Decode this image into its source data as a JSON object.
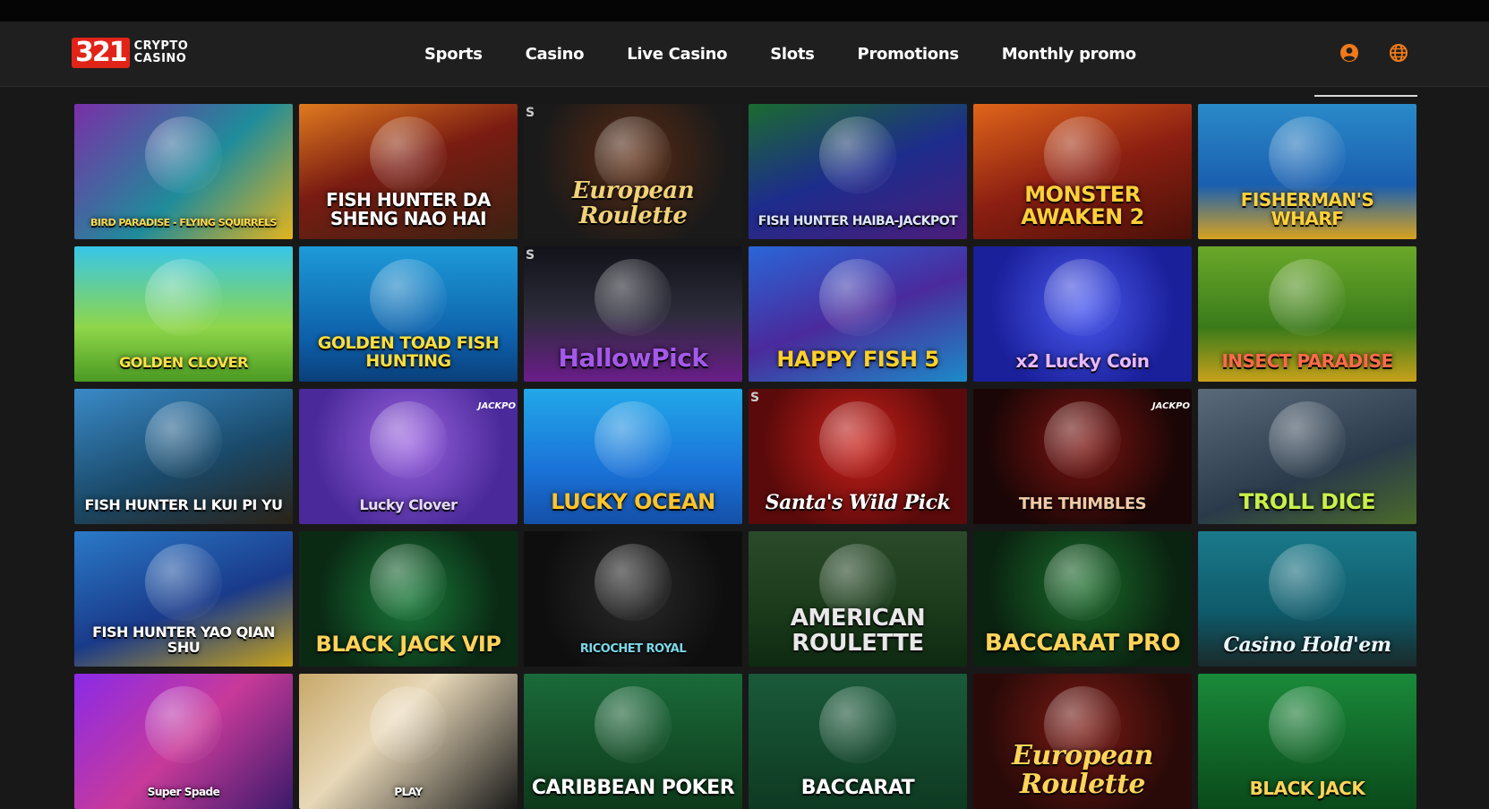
{
  "header": {
    "logo_number": "321",
    "logo_line1": "CRYPTO",
    "logo_line2": "CASINO",
    "nav": [
      "Sports",
      "Casino",
      "Live Casino",
      "Slots",
      "Promotions",
      "Monthly promo"
    ],
    "accent": "#f07a1a"
  },
  "games": [
    {
      "title": "BIRD PARADISE - FLYING SQUIRRELS",
      "bg": "linear-gradient(135deg,#7a2fa8,#1f8c9a 55%,#e3b41c)",
      "color": "#ffd84a",
      "size": 11
    },
    {
      "title": "FISH HUNTER DA SHENG NAO HAI",
      "bg": "linear-gradient(160deg,#e07a1f,#7a1c12 45%,#3a2212)",
      "color": "#ffffff",
      "size": 20
    },
    {
      "title": "European Roulette",
      "bg": "radial-gradient(circle at 50% 40%,#5a2a12,#1a1a1a 70%)",
      "color": "#f1d27a",
      "size": 26,
      "serif": true,
      "s": "S"
    },
    {
      "title": "FISH HUNTER HAIBA-JACKPOT",
      "bg": "linear-gradient(160deg,#1b6b30,#1d2c8c 50%,#4b1d7a)",
      "color": "#dde7ff",
      "size": 14
    },
    {
      "title": "MONSTER AWAKEN 2",
      "bg": "linear-gradient(160deg,#e0651a,#8c1f12 50%,#4a1008)",
      "color": "#ffcf3a",
      "size": 24
    },
    {
      "title": "FISHERMAN'S WHARF",
      "bg": "linear-gradient(180deg,#2a8ac8,#1a5fb0 60%,#d8a21f)",
      "color": "#ffd13a",
      "size": 20
    },
    {
      "title": "GOLDEN CLOVER",
      "bg": "linear-gradient(180deg,#38c6e8,#8fd64a 60%,#4a9a22)",
      "color": "#ffe04a",
      "size": 16
    },
    {
      "title": "GOLDEN TOAD FISH HUNTING",
      "bg": "linear-gradient(180deg,#1e9ad8,#0d5ea8 70%,#0a3f7a)",
      "color": "#ffde3a",
      "size": 19
    },
    {
      "title": "HallowPick",
      "bg": "linear-gradient(180deg,#12121a,#2c2c3a 50%,#6a1d8a)",
      "color": "#a35ae8",
      "size": 28,
      "s": "S"
    },
    {
      "title": "HAPPY FISH 5",
      "bg": "linear-gradient(160deg,#2a66d8,#4a2a9c 50%,#1d8ac8)",
      "color": "#ffd02a",
      "size": 24
    },
    {
      "title": "x2 Lucky Coin",
      "bg": "radial-gradient(circle at 50% 45%,#4a5af0,#1a1f9a 70%)",
      "color": "#e9b8ff",
      "size": 20
    },
    {
      "title": "INSECT PARADISE",
      "bg": "linear-gradient(180deg,#6aa82a,#3a7a1a 60%,#c8a21a)",
      "color": "#ff6a4a",
      "size": 20
    },
    {
      "title": "FISH HUNTER LI KUI PI YU",
      "bg": "linear-gradient(160deg,#3a8ac8,#1a4a6a 55%,#2a2218)",
      "color": "#ffffff",
      "size": 16
    },
    {
      "title": "Lucky Clover",
      "bg": "radial-gradient(circle at 50% 40%,#9a62e0,#4a2a9a 70%)",
      "color": "#e6daff",
      "size": 16,
      "badge": "JACKPO"
    },
    {
      "title": "LUCKY OCEAN",
      "bg": "linear-gradient(180deg,#22a8e8,#1a72d8 60%,#1450a8)",
      "color": "#ffc42a",
      "size": 24
    },
    {
      "title": "Santa's Wild Pick",
      "bg": "radial-gradient(circle at 50% 40%,#c8201a,#5a0a0a 70%)",
      "color": "#ffffff",
      "size": 22,
      "serif": true,
      "s": "S"
    },
    {
      "title": "THE THIMBLES",
      "bg": "radial-gradient(circle at 50% 40%,#7a1410,#1a0606 70%)",
      "color": "#f0c9a8",
      "size": 18,
      "badge": "JACKPO"
    },
    {
      "title": "TROLL DICE",
      "bg": "linear-gradient(160deg,#5a6a7a,#2a3a4a 60%,#4a6a2a)",
      "color": "#c8f04a",
      "size": 24
    },
    {
      "title": "FISH HUNTER YAO QIAN SHU",
      "bg": "linear-gradient(160deg,#2a7ac8,#1a3a8a 55%,#c8a21a)",
      "color": "#ffffff",
      "size": 16
    },
    {
      "title": "BLACK JACK VIP",
      "bg": "radial-gradient(circle at 50% 50%,#1a7a3a,#0a2a14 70%)",
      "color": "#ffd35a",
      "size": 24
    },
    {
      "title": "RICOCHET ROYAL",
      "bg": "radial-gradient(circle at 50% 45%,#2a2a2a,#0e0e0e 70%)",
      "color": "#7ad8e8",
      "size": 13
    },
    {
      "title": "AMERICAN ROULETTE",
      "bg": "linear-gradient(180deg,#2a4a2a,#1a3a1a 60%,#0e2a12)",
      "color": "#e8e8e8",
      "size": 26
    },
    {
      "title": "BACCARAT PRO",
      "bg": "radial-gradient(circle at 50% 40%,#1a6a2a,#0a2210 70%)",
      "color": "#ffd45a",
      "size": 26
    },
    {
      "title": "Casino Hold'em",
      "bg": "linear-gradient(180deg,#1a7a8a,#0e5a6a 60%,#1a2a2a)",
      "color": "#e8f8ff",
      "size": 22,
      "serif": true
    },
    {
      "title": "Super Spade",
      "bg": "linear-gradient(135deg,#8a2ae8,#c83a9a 50%,#3a1a6a)",
      "color": "#ffffff",
      "size": 12
    },
    {
      "title": "PLAY",
      "bg": "linear-gradient(135deg,#c8a86a,#e8d8b8 40%,#1a1a1a)",
      "color": "#ffffff",
      "size": 12
    },
    {
      "title": "CARIBBEAN POKER",
      "bg": "linear-gradient(180deg,#1a6a3a,#0e3a1a)",
      "color": "#ffffff",
      "size": 22
    },
    {
      "title": "BACCARAT",
      "bg": "linear-gradient(180deg,#1a5a3a,#0e3a22)",
      "color": "#ffffff",
      "size": 22
    },
    {
      "title": "European Roulette",
      "bg": "radial-gradient(circle at 50% 40%,#7a1a14,#2a0a08 70%)",
      "color": "#ffd45a",
      "size": 30,
      "serif": true
    },
    {
      "title": "BLACK JACK",
      "bg": "linear-gradient(180deg,#1a8a3a,#0a4a1a)",
      "color": "#ffd45a",
      "size": 20
    }
  ]
}
